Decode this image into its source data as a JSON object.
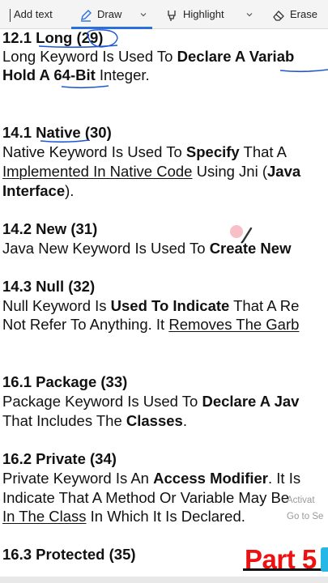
{
  "toolbar": {
    "add_text": "Add text",
    "draw": "Draw",
    "highlight": "Highlight",
    "erase": "Erase"
  },
  "doc": {
    "s1": {
      "heading_num": "12.1 Long (",
      "heading_num2": "29",
      "heading_end": ")",
      "l1a": "Long Keyword Is Used To ",
      "l1b": "Declare A Variab",
      "l2a": "Hold A ",
      "l2b": "64-Bit",
      "l2c": " Integer."
    },
    "s2": {
      "heading_a": "14.1 ",
      "heading_b": "Native",
      "heading_c": " (30)",
      "l1a": "Native Keyword Is Used To ",
      "l1b": "Specify",
      "l1c": " That A ",
      "l2a": "Implemented In Native Code",
      "l2b": " Using Jni (",
      "l2c": "Java",
      "l3": "Interface",
      "l3b": ")."
    },
    "s3": {
      "heading": "14.2 New (31)",
      "l1a": "Java New Keyword Is Used To ",
      "l1b": "Create New"
    },
    "s4": {
      "heading": "14.3 Null (32)",
      "l1a": "Null Keyword Is ",
      "l1b": "Used To Indicate",
      "l1c": " That A Re",
      "l2a": "Not Refer To Anything. It ",
      "l2b": "Removes The Garb"
    },
    "s5": {
      "heading": "16.1 Package (33)",
      "l1a": "Package Keyword Is Used To ",
      "l1b": "Declare A Jav",
      "l2a": "That Includes The ",
      "l2b": "Classes",
      "l2c": "."
    },
    "s6": {
      "heading": "16.2 Private (34)",
      "l1a": "Private Keyword Is An ",
      "l1b": "Access Modifier",
      "l1c": ". It Is",
      "l2": "Indicate That A Method Or Variable May Be",
      "l3a": "In The Class",
      "l3b": " In Which It Is Declared."
    },
    "s7": {
      "heading": "16.3 Protected (35)"
    }
  },
  "watermark": {
    "line1": "Activat",
    "line2": "Go to Se"
  },
  "badge": {
    "text": "Part 5"
  },
  "colors": {
    "ink": "#1f56d6",
    "badge": "#ee1111",
    "tab_indicator": "#2a6fdb"
  }
}
